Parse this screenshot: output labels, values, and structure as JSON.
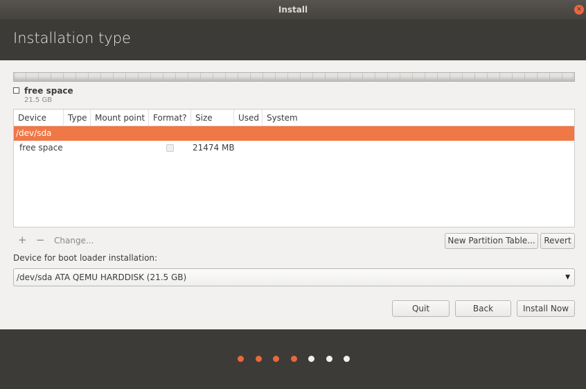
{
  "window": {
    "title": "Install",
    "close_icon": "close-icon"
  },
  "header": {
    "title": "Installation type"
  },
  "partition_bar": {
    "legend_label": "free space",
    "legend_size": "21.5 GB"
  },
  "table": {
    "columns": [
      "Device",
      "Type",
      "Mount point",
      "Format?",
      "Size",
      "Used",
      "System"
    ],
    "rows": [
      {
        "device": "/dev/sda",
        "selected": true
      },
      {
        "device": "free space",
        "type": "",
        "mount": "",
        "format": false,
        "size": "21474 MB",
        "used": "",
        "system": ""
      }
    ]
  },
  "toolbar": {
    "add": "+",
    "remove": "−",
    "change": "Change...",
    "new_table": "New Partition Table...",
    "revert": "Revert"
  },
  "bootloader": {
    "label": "Device for boot loader installation:",
    "selected": "/dev/sda ATA QEMU HARDDISK (21.5 GB)"
  },
  "buttons": {
    "quit": "Quit",
    "back": "Back",
    "install": "Install Now"
  },
  "progress": {
    "total_steps": 7,
    "completed_steps": 4,
    "active_color": "#e9683c",
    "inactive_color": "#f2f1f0"
  },
  "colors": {
    "accent": "#f07746"
  }
}
